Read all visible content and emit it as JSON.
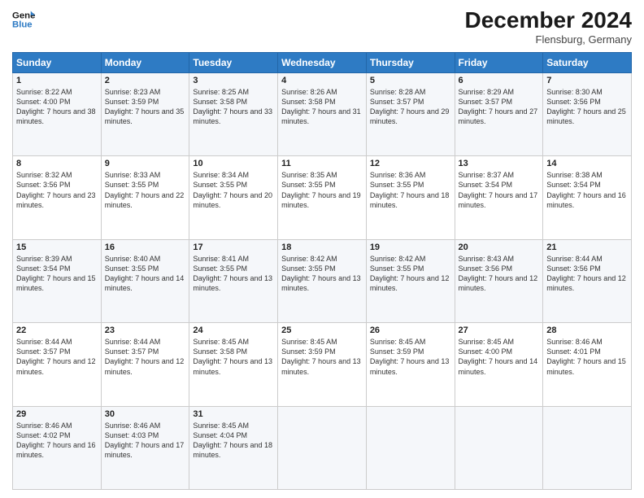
{
  "header": {
    "logo_line1": "General",
    "logo_line2": "Blue",
    "month": "December 2024",
    "location": "Flensburg, Germany"
  },
  "days_of_week": [
    "Sunday",
    "Monday",
    "Tuesday",
    "Wednesday",
    "Thursday",
    "Friday",
    "Saturday"
  ],
  "weeks": [
    [
      {
        "day": "1",
        "sunrise": "8:22 AM",
        "sunset": "4:00 PM",
        "daylight": "7 hours and 38 minutes."
      },
      {
        "day": "2",
        "sunrise": "8:23 AM",
        "sunset": "3:59 PM",
        "daylight": "7 hours and 35 minutes."
      },
      {
        "day": "3",
        "sunrise": "8:25 AM",
        "sunset": "3:58 PM",
        "daylight": "7 hours and 33 minutes."
      },
      {
        "day": "4",
        "sunrise": "8:26 AM",
        "sunset": "3:58 PM",
        "daylight": "7 hours and 31 minutes."
      },
      {
        "day": "5",
        "sunrise": "8:28 AM",
        "sunset": "3:57 PM",
        "daylight": "7 hours and 29 minutes."
      },
      {
        "day": "6",
        "sunrise": "8:29 AM",
        "sunset": "3:57 PM",
        "daylight": "7 hours and 27 minutes."
      },
      {
        "day": "7",
        "sunrise": "8:30 AM",
        "sunset": "3:56 PM",
        "daylight": "7 hours and 25 minutes."
      }
    ],
    [
      {
        "day": "8",
        "sunrise": "8:32 AM",
        "sunset": "3:56 PM",
        "daylight": "7 hours and 23 minutes."
      },
      {
        "day": "9",
        "sunrise": "8:33 AM",
        "sunset": "3:55 PM",
        "daylight": "7 hours and 22 minutes."
      },
      {
        "day": "10",
        "sunrise": "8:34 AM",
        "sunset": "3:55 PM",
        "daylight": "7 hours and 20 minutes."
      },
      {
        "day": "11",
        "sunrise": "8:35 AM",
        "sunset": "3:55 PM",
        "daylight": "7 hours and 19 minutes."
      },
      {
        "day": "12",
        "sunrise": "8:36 AM",
        "sunset": "3:55 PM",
        "daylight": "7 hours and 18 minutes."
      },
      {
        "day": "13",
        "sunrise": "8:37 AM",
        "sunset": "3:54 PM",
        "daylight": "7 hours and 17 minutes."
      },
      {
        "day": "14",
        "sunrise": "8:38 AM",
        "sunset": "3:54 PM",
        "daylight": "7 hours and 16 minutes."
      }
    ],
    [
      {
        "day": "15",
        "sunrise": "8:39 AM",
        "sunset": "3:54 PM",
        "daylight": "7 hours and 15 minutes."
      },
      {
        "day": "16",
        "sunrise": "8:40 AM",
        "sunset": "3:55 PM",
        "daylight": "7 hours and 14 minutes."
      },
      {
        "day": "17",
        "sunrise": "8:41 AM",
        "sunset": "3:55 PM",
        "daylight": "7 hours and 13 minutes."
      },
      {
        "day": "18",
        "sunrise": "8:42 AM",
        "sunset": "3:55 PM",
        "daylight": "7 hours and 13 minutes."
      },
      {
        "day": "19",
        "sunrise": "8:42 AM",
        "sunset": "3:55 PM",
        "daylight": "7 hours and 12 minutes."
      },
      {
        "day": "20",
        "sunrise": "8:43 AM",
        "sunset": "3:56 PM",
        "daylight": "7 hours and 12 minutes."
      },
      {
        "day": "21",
        "sunrise": "8:44 AM",
        "sunset": "3:56 PM",
        "daylight": "7 hours and 12 minutes."
      }
    ],
    [
      {
        "day": "22",
        "sunrise": "8:44 AM",
        "sunset": "3:57 PM",
        "daylight": "7 hours and 12 minutes."
      },
      {
        "day": "23",
        "sunrise": "8:44 AM",
        "sunset": "3:57 PM",
        "daylight": "7 hours and 12 minutes."
      },
      {
        "day": "24",
        "sunrise": "8:45 AM",
        "sunset": "3:58 PM",
        "daylight": "7 hours and 13 minutes."
      },
      {
        "day": "25",
        "sunrise": "8:45 AM",
        "sunset": "3:59 PM",
        "daylight": "7 hours and 13 minutes."
      },
      {
        "day": "26",
        "sunrise": "8:45 AM",
        "sunset": "3:59 PM",
        "daylight": "7 hours and 13 minutes."
      },
      {
        "day": "27",
        "sunrise": "8:45 AM",
        "sunset": "4:00 PM",
        "daylight": "7 hours and 14 minutes."
      },
      {
        "day": "28",
        "sunrise": "8:46 AM",
        "sunset": "4:01 PM",
        "daylight": "7 hours and 15 minutes."
      }
    ],
    [
      {
        "day": "29",
        "sunrise": "8:46 AM",
        "sunset": "4:02 PM",
        "daylight": "7 hours and 16 minutes."
      },
      {
        "day": "30",
        "sunrise": "8:46 AM",
        "sunset": "4:03 PM",
        "daylight": "7 hours and 17 minutes."
      },
      {
        "day": "31",
        "sunrise": "8:45 AM",
        "sunset": "4:04 PM",
        "daylight": "7 hours and 18 minutes."
      },
      null,
      null,
      null,
      null
    ]
  ]
}
